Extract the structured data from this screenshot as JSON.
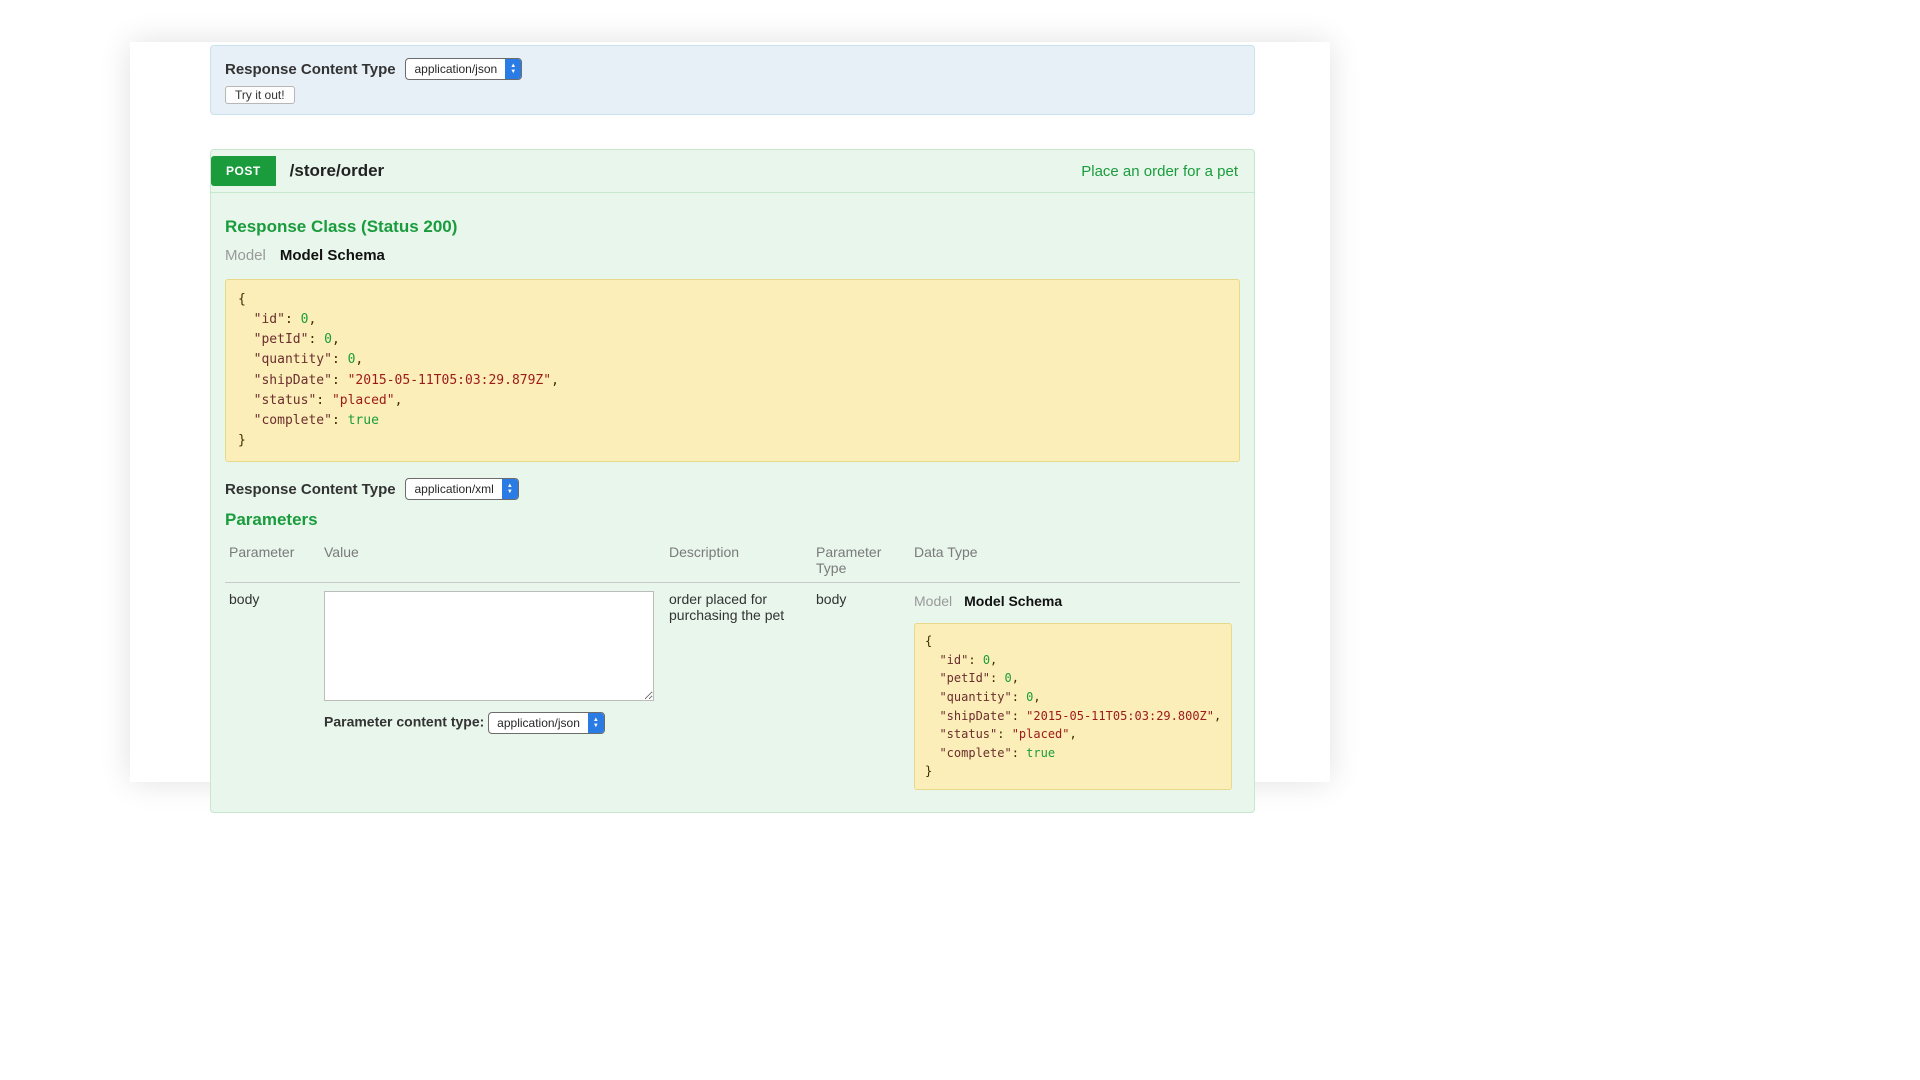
{
  "top_panel": {
    "rct_label": "Response Content Type",
    "rct_value": "application/json",
    "try_label": "Try it out!"
  },
  "operation": {
    "method": "POST",
    "path": "/store/order",
    "summary": "Place an order for a pet",
    "response_class_title": "Response Class (Status 200)",
    "tabs": {
      "model": "Model",
      "schema": "Model Schema"
    },
    "schema_example": {
      "id": 0,
      "petId": 0,
      "quantity": 0,
      "shipDate": "2015-05-11T05:03:29.879Z",
      "status": "placed",
      "complete": true
    },
    "rct_label": "Response Content Type",
    "rct_value": "application/xml",
    "parameters_title": "Parameters",
    "param_headers": {
      "parameter": "Parameter",
      "value": "Value",
      "description": "Description",
      "param_type": "Parameter Type",
      "data_type": "Data Type"
    },
    "param_row": {
      "name": "body",
      "value": "",
      "description": "order placed for purchasing the pet",
      "param_type": "body",
      "content_type_label": "Parameter content type:",
      "content_type_value": "application/json",
      "dt_tabs": {
        "model": "Model",
        "schema": "Model Schema"
      },
      "dt_schema_example": {
        "id": 0,
        "petId": 0,
        "quantity": 0,
        "shipDate": "2015-05-11T05:03:29.800Z",
        "status": "placed",
        "complete": true
      }
    }
  }
}
